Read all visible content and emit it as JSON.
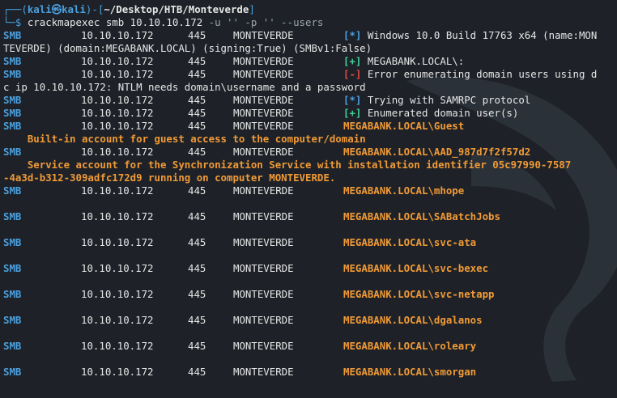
{
  "prompt": {
    "tree_top": "┌──(",
    "user": "kali",
    "skull": "㉿",
    "host": "kali",
    "open": ")-[",
    "cwd": "~/Desktop/HTB/Monteverde",
    "close": "]",
    "tree_bottom": "└─$ ",
    "command": "crackmapexec",
    "args": " smb 10.10.10.172 ",
    "flags": "-u '' -p '' --users"
  },
  "proto": "SMB",
  "ip": "10.10.10.172",
  "port": "445",
  "host": "MONTEVERDE",
  "lines": {
    "l1_mark": "[*]",
    "l1_msg": " Windows 10.0 Build 17763 x64 (name:MON",
    "l1_wrap": "TEVERDE) (domain:MEGABANK.LOCAL) (signing:True) (SMBv1:False)",
    "l2_mark": "[+]",
    "l2_msg": " MEGABANK.LOCAL\\:",
    "l3_mark": "[-]",
    "l3_msg": " Error enumerating domain users using d",
    "l3_wrap": "c ip 10.10.10.172: NTLM needs domain\\username and a password",
    "l4_mark": "[*]",
    "l4_msg": " Trying with SAMRPC protocol",
    "l5_mark": "[+]",
    "l5_msg": " Enumerated domain user(s)"
  },
  "users": [
    {
      "name": "MEGABANK.LOCAL\\Guest",
      "desc": "    Built-in account for guest access to the computer/domain"
    },
    {
      "name": "MEGABANK.LOCAL\\AAD_987d7f2f57d2",
      "desc": "    Service account for the Synchronization Service with installation identifier 05c97990-7587",
      "desc2": "-4a3d-b312-309adfc172d9 running on computer MONTEVERDE."
    },
    {
      "name": "MEGABANK.LOCAL\\mhope"
    },
    {
      "name": "MEGABANK.LOCAL\\SABatchJobs"
    },
    {
      "name": "MEGABANK.LOCAL\\svc-ata"
    },
    {
      "name": "MEGABANK.LOCAL\\svc-bexec"
    },
    {
      "name": "MEGABANK.LOCAL\\svc-netapp"
    },
    {
      "name": "MEGABANK.LOCAL\\dgalanos"
    },
    {
      "name": "MEGABANK.LOCAL\\roleary"
    },
    {
      "name": "MEGABANK.LOCAL\\smorgan"
    }
  ]
}
